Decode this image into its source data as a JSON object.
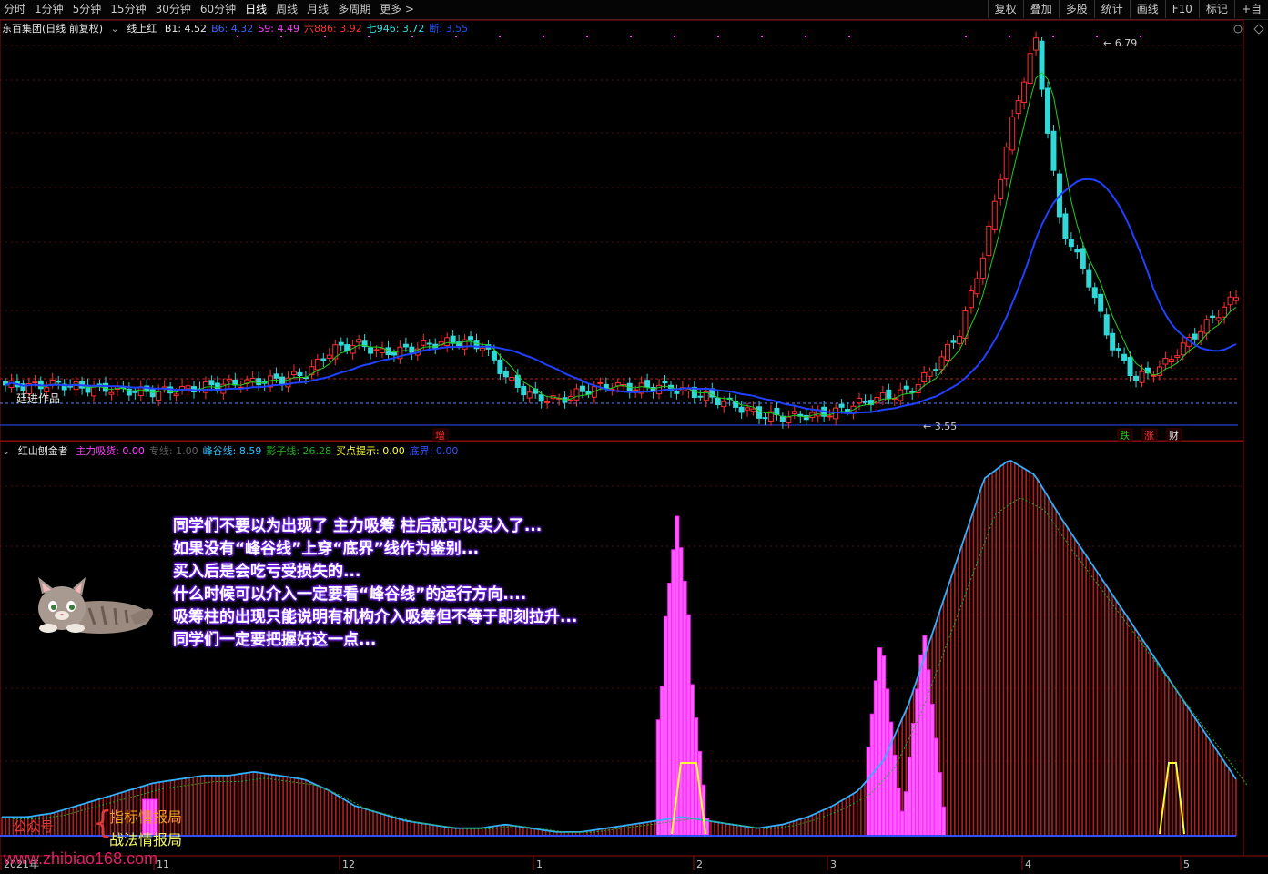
{
  "toolbar": {
    "periods": [
      "分时",
      "1分钟",
      "5分钟",
      "15分钟",
      "30分钟",
      "60分钟",
      "日线",
      "周线",
      "月线",
      "多周期",
      "更多 >"
    ],
    "active_period": "日线",
    "right_buttons": [
      "复权",
      "叠加",
      "多股",
      "统计",
      "画线",
      "F10",
      "标记",
      "+自"
    ]
  },
  "main_panel": {
    "stock_title": "东百集团(日线 前复权)",
    "indicator_name": "线上红",
    "legend": [
      {
        "label": "B1: 4.52",
        "color": "#e8e8e8"
      },
      {
        "label": "B6: 4.32",
        "color": "#3a62ff"
      },
      {
        "label": "S9: 4.49",
        "color": "#ff40ff"
      },
      {
        "label": "六886: 3.92",
        "color": "#ff3030"
      },
      {
        "label": "七946: 3.72",
        "color": "#30e0e0"
      },
      {
        "label": "断: 3.55",
        "color": "#2050ff"
      }
    ],
    "high_label": "6.79",
    "low_label": "3.55",
    "watermark": "廷进作品",
    "markers": [
      {
        "text": "增",
        "color": "#ff3030"
      },
      {
        "text": "跌",
        "color": "#20d020"
      },
      {
        "text": "涨",
        "color": "#ff3030"
      },
      {
        "text": "财",
        "color": "#e0e0e0"
      }
    ]
  },
  "sub_panel": {
    "indicator_name": "红山刨金者",
    "legend": [
      {
        "label": "主力吸货: 0.00",
        "color": "#ff40ff"
      },
      {
        "label": "专线: 1.00",
        "color": "#606060"
      },
      {
        "label": "峰谷线: 8.59",
        "color": "#30c0ff"
      },
      {
        "label": "影子线: 26.28",
        "color": "#20b020"
      },
      {
        "label": "买点提示: 0.00",
        "color": "#ffff30"
      },
      {
        "label": "底界: 0.00",
        "color": "#3050ff"
      }
    ]
  },
  "x_axis": {
    "labels": [
      "2021年",
      "11",
      "12",
      "1",
      "2",
      "3",
      "4",
      "5"
    ]
  },
  "caption_lines": [
    "同学们不要以为出现了 主力吸筹 柱后就可以买入了...",
    "如果没有“峰谷线”上穿“底界”线作为鉴别...",
    "买入后是会吃亏受损失的...",
    "什么时候可以介入一定要看“峰谷线”的运行方向....",
    "吸筹柱的出现只能说明有机构介入吸筹但不等于即刻拉升...",
    "同学们一定要把握好这一点..."
  ],
  "footer": {
    "public_account": "公众号",
    "line1": "指标情报局",
    "line2": "战法情报局",
    "site": "www.zhibiao168.com"
  },
  "chart_data": [
    {
      "type": "candlestick",
      "title": "东百集团(日线 前复权)",
      "price_range_shown": [
        3.55,
        6.79
      ],
      "series": [
        {
          "name": "close_approx",
          "values": [
            3.85,
            3.84,
            3.86,
            3.83,
            3.82,
            3.8,
            3.79,
            3.81,
            3.84,
            3.86,
            3.88,
            3.9,
            3.95,
            4.15,
            4.2,
            4.12,
            4.15,
            4.2,
            4.22,
            4.18,
            3.9,
            3.75,
            3.72,
            3.8,
            3.85,
            3.82,
            3.84,
            3.8,
            3.75,
            3.68,
            3.6,
            3.58,
            3.6,
            3.62,
            3.7,
            3.75,
            3.8,
            4.0,
            4.3,
            5.0,
            6.0,
            6.79,
            5.2,
            4.8,
            4.2,
            3.9,
            4.0,
            4.2,
            4.4,
            4.6
          ]
        }
      ]
    },
    {
      "type": "bar",
      "title": "红山刨金者",
      "series": [
        {
          "name": "主力吸货",
          "values": [
            0,
            0,
            0,
            0,
            0,
            0,
            0,
            0,
            0,
            0,
            0,
            0,
            0,
            0,
            0,
            0,
            0,
            0,
            0,
            0,
            0,
            0,
            50,
            80,
            100,
            80,
            50,
            20,
            0,
            0,
            0,
            0,
            0,
            0,
            0,
            0,
            0,
            0,
            0,
            0,
            0,
            0,
            0,
            0,
            0,
            0,
            0,
            0,
            0,
            0
          ]
        },
        {
          "name": "峰谷线",
          "values": [
            5,
            5,
            6,
            8,
            10,
            12,
            14,
            15,
            16,
            16,
            17,
            16,
            15,
            12,
            8,
            6,
            4,
            3,
            2,
            2,
            3,
            2,
            1,
            1,
            2,
            3,
            4,
            5,
            4,
            3,
            2,
            3,
            5,
            8,
            12,
            20,
            35,
            55,
            75,
            95,
            100,
            96,
            85,
            75,
            65,
            55,
            45,
            35,
            25,
            15
          ]
        }
      ]
    }
  ]
}
